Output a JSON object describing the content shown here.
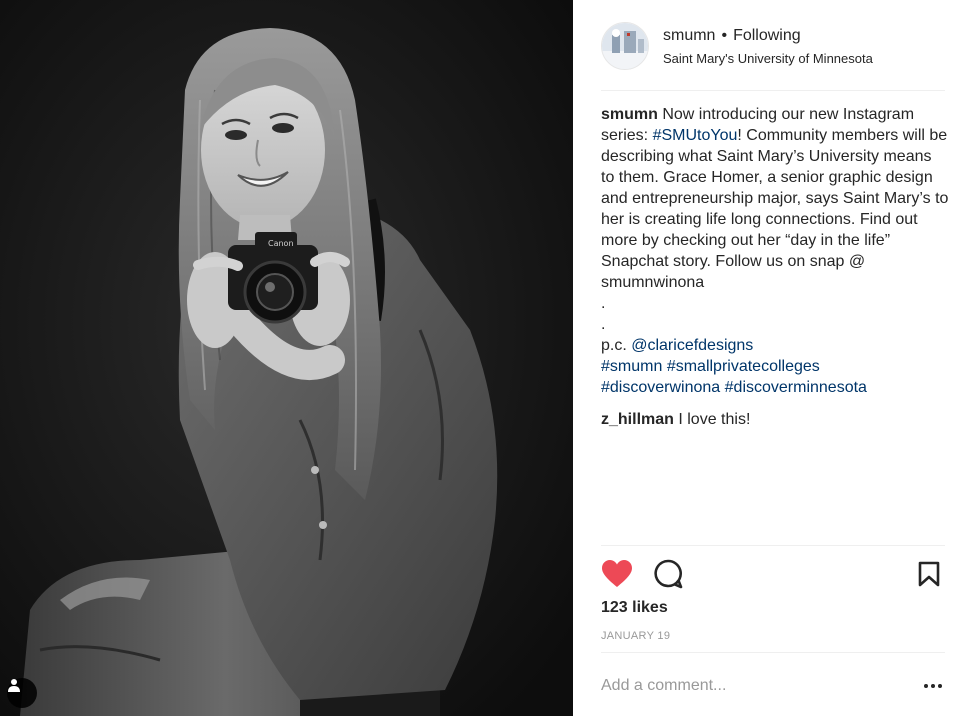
{
  "post": {
    "username": "smumn",
    "separator": "•",
    "follow_status": "Following",
    "location": "Saint Mary's University of Minnesota",
    "caption": {
      "username": "smumn",
      "text_1": " Now introducing our new Instagram series: ",
      "hashtag_1": "#SMUtoYou",
      "text_2": "! Community members will be describing what Saint Mary’s University means to them. Grace Homer, a senior graphic design and entrepreneurship major, says Saint Mary’s to her is creating life long connections. Find out more by checking out her “day in the life” Snapchat story. Follow us on snap @ smumnwinona",
      "dot_1": ".",
      "dot_2": ".",
      "pc_label": "p.c. ",
      "pc_mention": "@claricefdesigns",
      "hashtag_2": "#smumn",
      "hashtag_3": "#smallprivatecolleges",
      "hashtag_4": "#discoverwinona",
      "hashtag_5": "#discoverminnesota"
    },
    "comment": {
      "username": "z_hillman",
      "text": " I love this!"
    },
    "likes": "123 likes",
    "date": "JANUARY 19",
    "comment_placeholder": "Add a comment...",
    "icons": {
      "like": "heart-icon",
      "comment": "comment-bubble-icon",
      "save": "bookmark-icon",
      "more": "more-options-icon",
      "tag": "user-tag-icon"
    },
    "colors": {
      "like_red": "#ed4956",
      "link_blue": "#003569",
      "meta_gray": "#999999",
      "text_dark": "#262626",
      "divider": "#efefef",
      "photo_bg": "#111111"
    }
  }
}
